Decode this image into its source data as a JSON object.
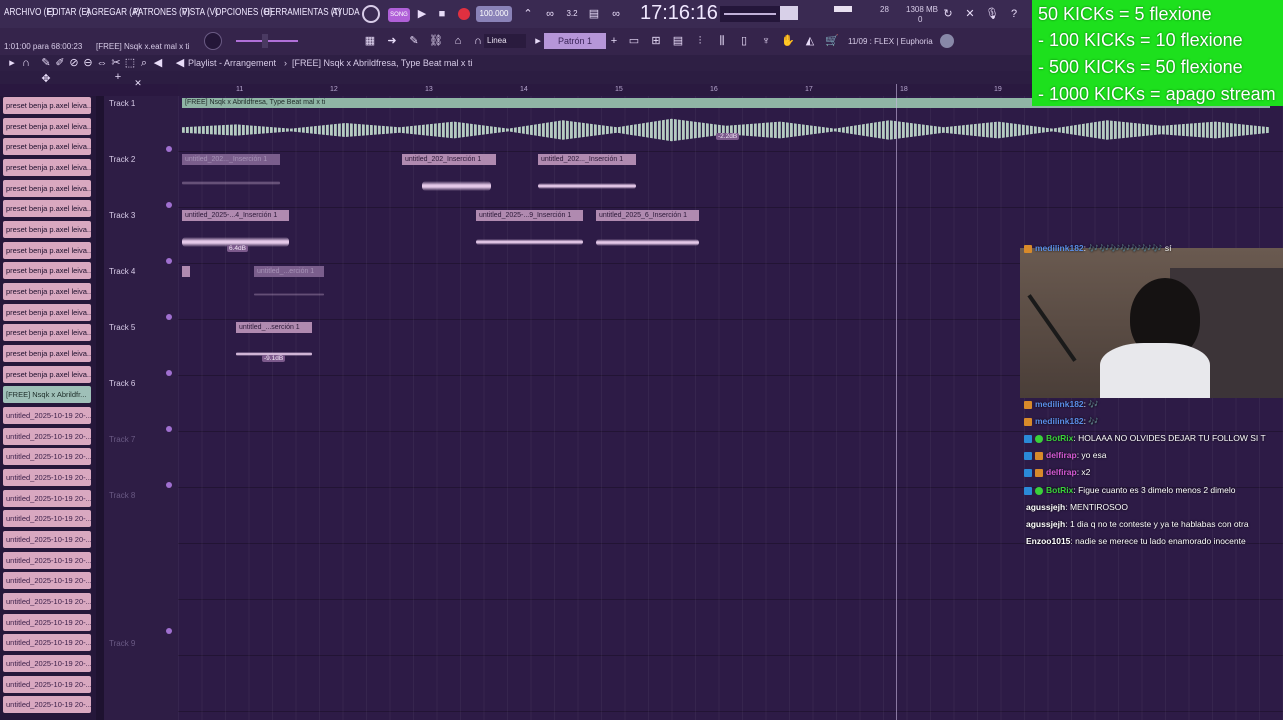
{
  "menu": [
    "ARCHIVO (F)",
    "EDITAR (E)",
    "AGREGAR (A)",
    "PATRONES (P)",
    "VISTA (V)",
    "OPCIONES (O)",
    "HERRAMIENTAS (T)",
    "AYUDA"
  ],
  "transport": {
    "tempo": "100.000",
    "time": "17:16:16",
    "cpu": "28",
    "mem": "1308 MB",
    "mem_sub": "0"
  },
  "hint": {
    "position": "1:01:00 para 68:00:23",
    "project": "[FREE] Nsqk x.eat mal x ti"
  },
  "snap": {
    "label": "Linea",
    "pattern": "Patrón 1"
  },
  "plugin_info": "11/09 : FLEX | Euphoria",
  "playlist": {
    "title": "Playlist - Arrangement",
    "breadcrumb": "[FREE] Nsqk x Abrildfresa, Type Beat mal x ti"
  },
  "ruler": [
    "11",
    "12",
    "13",
    "14",
    "15",
    "16",
    "17",
    "18",
    "19"
  ],
  "browser": {
    "items": [
      "preset benja p.axel leiva...",
      "preset benja p.axel leiva...",
      "preset benja p.axel leiva...",
      "preset benja p.axel leiva...",
      "preset benja p.axel leiva...",
      "preset benja p.axel leiva...",
      "preset benja p.axel leiva...",
      "preset benja p.axel leiva...",
      "preset benja p.axel leiva...",
      "preset benja p.axel leiva...",
      "preset benja p.axel leiva...",
      "preset benja p.axel leiva...",
      "preset benja p.axel leiva...",
      "preset benja p.axel leiva...",
      "[FREE] Nsqk x Abrildfr...",
      "untitled_2025-10-19 20-...",
      "untitled_2025-10-19 20-...",
      "untitled_2025-10-19 20-...",
      "untitled_2025-10-19 20-...",
      "untitled_2025-10-19 20-...",
      "untitled_2025-10-19 20-...",
      "untitled_2025-10-19 20-...",
      "untitled_2025-10-19 20-...",
      "untitled_2025-10-19 20-...",
      "untitled_2025-10-19 20-...",
      "untitled_2025-10-19 20-...",
      "untitled_2025-10-19 20-...",
      "untitled_2025-10-19 20-...",
      "untitled_2025-10-19 20-...",
      "untitled_2025-10-19 20-...",
      "untitled_2025-10-19 21-..."
    ]
  },
  "tracks": [
    "Track 1",
    "Track 2",
    "Track 3",
    "Track 4",
    "Track 5",
    "Track 6",
    "Track 7",
    "Track 8",
    "Track 9"
  ],
  "clips": {
    "t1": "[FREE] Nsqk x Abrildfresa, Type Beat mal x ti",
    "t1db": "-2.2dB",
    "t2a": "untitled_202..._Inserción 1",
    "t2b": "untitled_202_Inserción 1",
    "t2c": "untitled_202..._Inserción 1",
    "t3a": "untitled_2025-...4_Inserción 1",
    "t3b": "untitled_2025-...9_Inserción 1",
    "t3c": "untitled_2025_6_Inserción 1",
    "t3db": "6.4dB",
    "t4a": "untitled_...erción 1",
    "t5a": "untitled_...serción 1",
    "t5db": "-9.1dB"
  },
  "overlay": {
    "kicks": [
      "50 KICKs = 5 flexione",
      "- 100 KICKs = 10 flexione",
      "- 500 KICKs = 50 flexione",
      "- 1000 KICKs = apago stream"
    ]
  },
  "chat": [
    {
      "user": "medilink182",
      "text": ": 🎶🎶🎶🎶🎶🎶🎶 sí",
      "color": "#5b8ee8"
    },
    {
      "user": "medilink182",
      "text": ": 🎶",
      "color": "#5b8ee8"
    },
    {
      "user": "medilink182",
      "text": ": 🎶",
      "color": "#5b8ee8"
    },
    {
      "user": "BotRix",
      "text": ": HOLAAA NO OLVIDES DEJAR TU FOLLOW SI T",
      "color": "#3ad13a"
    },
    {
      "user": "delfirap",
      "text": ": yo esa",
      "color": "#d45ad4"
    },
    {
      "user": "delfirap",
      "text": ": x2",
      "color": "#d45ad4"
    },
    {
      "user": "BotRix",
      "text": ": Figue cuanto es 3 dimelo menos 2 dimelo",
      "color": "#3ad13a"
    },
    {
      "user": "agussjejh",
      "text": ": MENTIROSOO",
      "color": "#ffffff"
    },
    {
      "user": "agussjejh",
      "text": ": 1 dia q no te conteste y ya te hablabas con otra",
      "color": "#ffffff"
    },
    {
      "user": "Enzoo1015",
      "text": ": nadie se merece tu lado enamorado inocente",
      "color": "#ffffff"
    }
  ]
}
